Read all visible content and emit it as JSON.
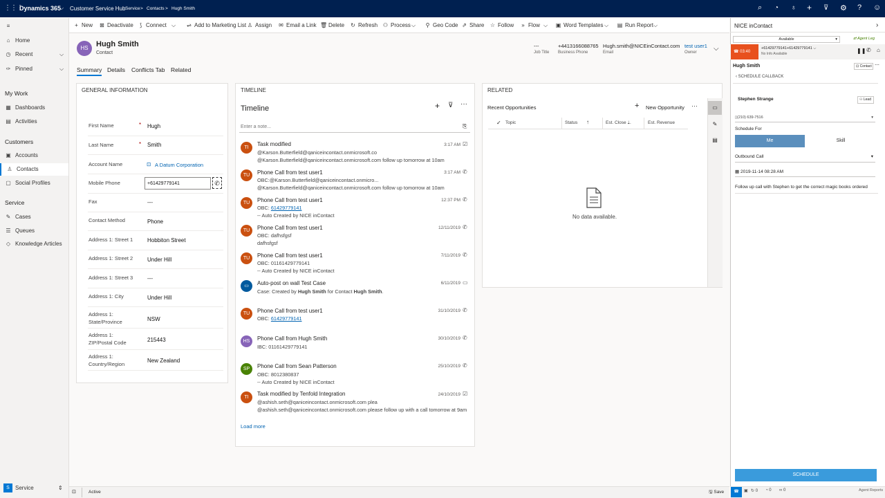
{
  "app": {
    "waffle": "⋮⋮⋮",
    "name": "Dynamics 365",
    "app_name": "Customer Service Hub",
    "breadcrumb": [
      "Service",
      ">",
      "Contacts",
      ">",
      "Hugh Smith"
    ]
  },
  "commands": [
    "New",
    "Deactivate",
    "Connect",
    "Add to Marketing List",
    "Assign",
    "Email a Link",
    "Delete",
    "Refresh",
    "Process",
    "Geo Code",
    "Share",
    "Follow",
    "Flow",
    "Word Templates",
    "Run Report"
  ],
  "sidebar": {
    "items": [
      "Home",
      "Recent",
      "Pinned"
    ],
    "my_work_header": "My Work",
    "my_work": [
      "Dashboards",
      "Activities"
    ],
    "customers_header": "Customers",
    "customers": [
      "Accounts",
      "Contacts",
      "Social Profiles"
    ],
    "service_header": "Service",
    "service": [
      "Cases",
      "Queues",
      "Knowledge Articles"
    ],
    "area_badge": "S",
    "area_label": "Service"
  },
  "record": {
    "initials": "HS",
    "name": "Hugh Smith",
    "type": "Contact",
    "header_fields": [
      {
        "value": "---",
        "label": "Job Title"
      },
      {
        "value": "+4413166088765",
        "label": "Business Phone"
      },
      {
        "value": "Hugh.smith@NICEinContact.com",
        "label": "Email"
      },
      {
        "value": "test user1",
        "label": "Owner"
      }
    ],
    "tabs": [
      "Summary",
      "Details",
      "Conflicts Tab",
      "Related"
    ]
  },
  "general": {
    "title": "GENERAL INFORMATION",
    "fields": [
      {
        "label": "First Name",
        "value": "Hugh",
        "req": "*"
      },
      {
        "label": "Last Name",
        "value": "Smith",
        "req": "*"
      },
      {
        "label": "Account Name",
        "value": "A Datum Corporation"
      },
      {
        "label": "Mobile Phone",
        "value": "+61429779141"
      },
      {
        "label": "Fax",
        "value": "---"
      },
      {
        "label": "Contact Method",
        "value": "Phone"
      },
      {
        "label": "Address 1: Street 1",
        "value": "Hobbiton Street"
      },
      {
        "label": "Address 1: Street 2",
        "value": "Under Hill"
      },
      {
        "label": "Address 1: Street 3",
        "value": "---"
      },
      {
        "label": "Address 1: City",
        "value": "Under Hill"
      },
      {
        "label": "Address 1: State/Province",
        "value": "NSW"
      },
      {
        "label": "Address 1: ZIP/Postal Code",
        "value": "215443"
      },
      {
        "label": "Address 1: Country/Region",
        "value": "New Zealand"
      }
    ]
  },
  "timeline": {
    "section": "TIMELINE",
    "title": "Timeline",
    "note_placeholder": "Enter a note...",
    "load_more": "Load more",
    "items": [
      {
        "initials": "TI",
        "color": "#ca5010",
        "title": "Task modified",
        "l1": "@Karson.Butterfield@qaniceincontact.onmicrosoft.co",
        "l2": "@Karson.Butterfield@qaniceincontact.onmicrosoft.com follow up tomorrow at 10am",
        "date": "3:17 AM",
        "icon": "☑"
      },
      {
        "initials": "TU",
        "color": "#ca5010",
        "title": "Phone Call from test user1",
        "l1": "OBC:@Karson.Butterfield@qaniceincontact.onmicro...",
        "l2": "@Karson.Butterfield@qaniceincontact.onmicrosoft.com follow up tomorrow at 10am",
        "date": "3:17 AM",
        "icon": "✆"
      },
      {
        "initials": "TU",
        "color": "#ca5010",
        "title": "Phone Call from test user1",
        "l1": "OBC: ",
        "link": "61429779141",
        "l2": "-- Auto Created by NICE inContact",
        "date": "12:37 PM",
        "icon": "✆"
      },
      {
        "initials": "TU",
        "color": "#ca5010",
        "title": "Phone Call from test user1",
        "l1": "OBC: dafhsfgsf",
        "l2": "dafhsfgsf",
        "date": "12/11/2019",
        "icon": "✆"
      },
      {
        "initials": "TU",
        "color": "#ca5010",
        "title": "Phone Call from test user1",
        "l1": "OBC: 01161429779141",
        "l2": "-- Auto Created by NICE inContact",
        "date": "7/11/2019",
        "icon": "✆"
      },
      {
        "initials": "",
        "color": "#005a9e",
        "title": "Auto-post on wall Test Case",
        "l1": "Case: Created by ",
        "bold1": "Hugh Smith",
        "l1b": " for Contact ",
        "bold2": "Hugh Smith",
        "l1c": ".",
        "l2": "",
        "date": "6/11/2019",
        "icon": "▭"
      },
      {
        "initials": "TU",
        "color": "#ca5010",
        "title": "Phone Call from test user1",
        "l1": "OBC: ",
        "link": "61429779141",
        "l2": "",
        "date": "31/10/2019",
        "icon": "✆"
      },
      {
        "initials": "HS",
        "color": "#8764b8",
        "title": "Phone Call from Hugh Smith",
        "l1": "IBC: 01161429779141",
        "l2": "",
        "date": "30/10/2019",
        "icon": "✆"
      },
      {
        "initials": "SP",
        "color": "#498205",
        "title": "Phone Call from Sean Patterson",
        "l1": "OBC: 8012380837",
        "l2": "-- Auto Created by NICE inContact",
        "date": "25/10/2019",
        "icon": "✆"
      },
      {
        "initials": "TI",
        "color": "#ca5010",
        "title": "Task modified by Tenfold Integration",
        "l1": "@ashish.seth@qaniceincontact.onmicrosoft.com  plea",
        "l2": "@ashish.seth@qaniceincontact.onmicrosoft.com  please follow up with a call tomorrow at 9am",
        "date": "24/10/2019",
        "icon": "☑"
      }
    ]
  },
  "related": {
    "section": "RELATED",
    "sub": "Recent Opportunities",
    "new_label": "New Opportunity",
    "cols": [
      "Topic",
      "Status",
      "Est. Close ...",
      "Est. Revenue"
    ],
    "empty": "No data available."
  },
  "nice": {
    "title": "NICE inContact",
    "status": "Available",
    "agent_leg": "Agent Leg",
    "timer": "03:40",
    "number": "+61429779141+61429779141",
    "sub": "No Info Available",
    "contact_name": "Hugh Smith",
    "contact_chip": "Contact",
    "back_label": "SCHEDULE CALLBACK",
    "callback_name": "Stephen Strange",
    "lead_chip": "Lead",
    "phone": "(210) 639-7516",
    "schedule_for": "Schedule For",
    "toggle_me": "Me",
    "toggle_skill": "Skill",
    "outbound": "Outbound Call",
    "datetime": "2019-11-14 08:28 AM",
    "note": "Follow up call with Stephen to get the correct magic books ordered",
    "schedule_btn": "SCHEDULE",
    "footer_counts": [
      "0",
      "0",
      "0"
    ],
    "agent_reports": "Agent Reports"
  },
  "statusbar": {
    "status": "Active",
    "save": "Save"
  }
}
